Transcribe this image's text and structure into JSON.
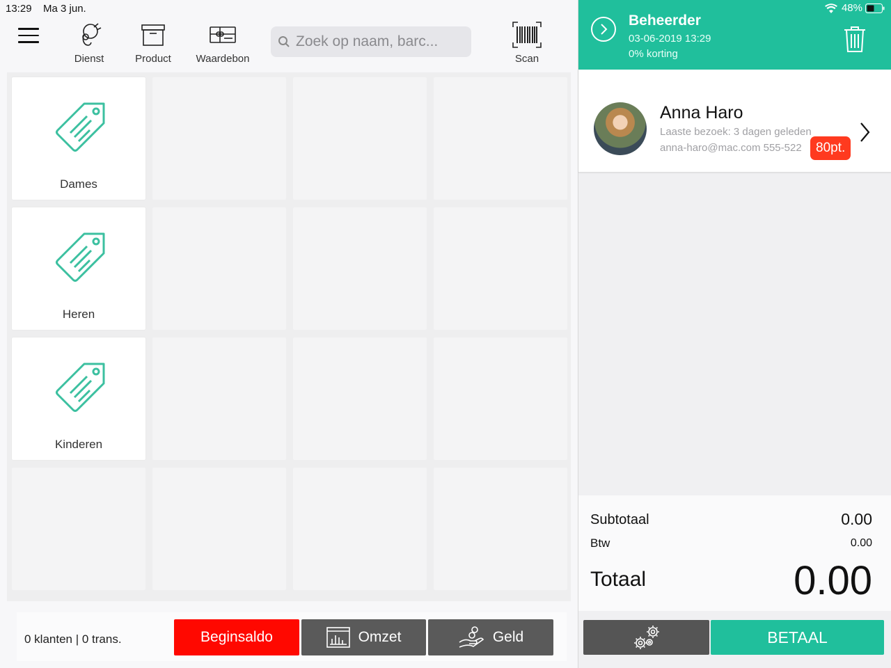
{
  "status": {
    "time": "13:29",
    "date": "Ma 3 jun.",
    "battery": "48%"
  },
  "toolbar": {
    "service_label": "Dienst",
    "product_label": "Product",
    "voucher_label": "Waardebon",
    "scan_label": "Scan"
  },
  "search": {
    "placeholder": "Zoek op naam, barc..."
  },
  "categories": [
    {
      "label": "Dames"
    },
    {
      "label": "Heren"
    },
    {
      "label": "Kinderen"
    }
  ],
  "footer": {
    "counts": "0 klanten | 0 trans.",
    "opening_balance_label": "Beginsaldo",
    "revenue_label": "Omzet",
    "cash_label": "Geld"
  },
  "header": {
    "title": "Beheerder",
    "datetime": "03-06-2019 13:29",
    "discount": "0% korting"
  },
  "customer": {
    "name": "Anna Haro",
    "last_visit": "Laaste bezoek: 3 dagen geleden",
    "contact": "anna-haro@mac.com 555-522",
    "points": "80pt."
  },
  "totals": {
    "subtotal_label": "Subtotaal",
    "subtotal_value": "0.00",
    "vat_label": "Btw",
    "vat_value": "0.00",
    "total_label": "Totaal",
    "total_value": "0.00"
  },
  "actions": {
    "pay_label": "BETAAL"
  },
  "colors": {
    "accent": "#20bf9c",
    "alert": "#ff0800",
    "dark_button": "#5a5a5a"
  },
  "icons": [
    "menu-icon",
    "service-icon",
    "product-box-icon",
    "voucher-icon",
    "search-icon",
    "barcode-icon",
    "price-tag-icon",
    "chart-icon",
    "money-hand-icon",
    "chevron-right-icon",
    "trash-icon",
    "wifi-icon",
    "battery-icon",
    "gear-icon"
  ]
}
